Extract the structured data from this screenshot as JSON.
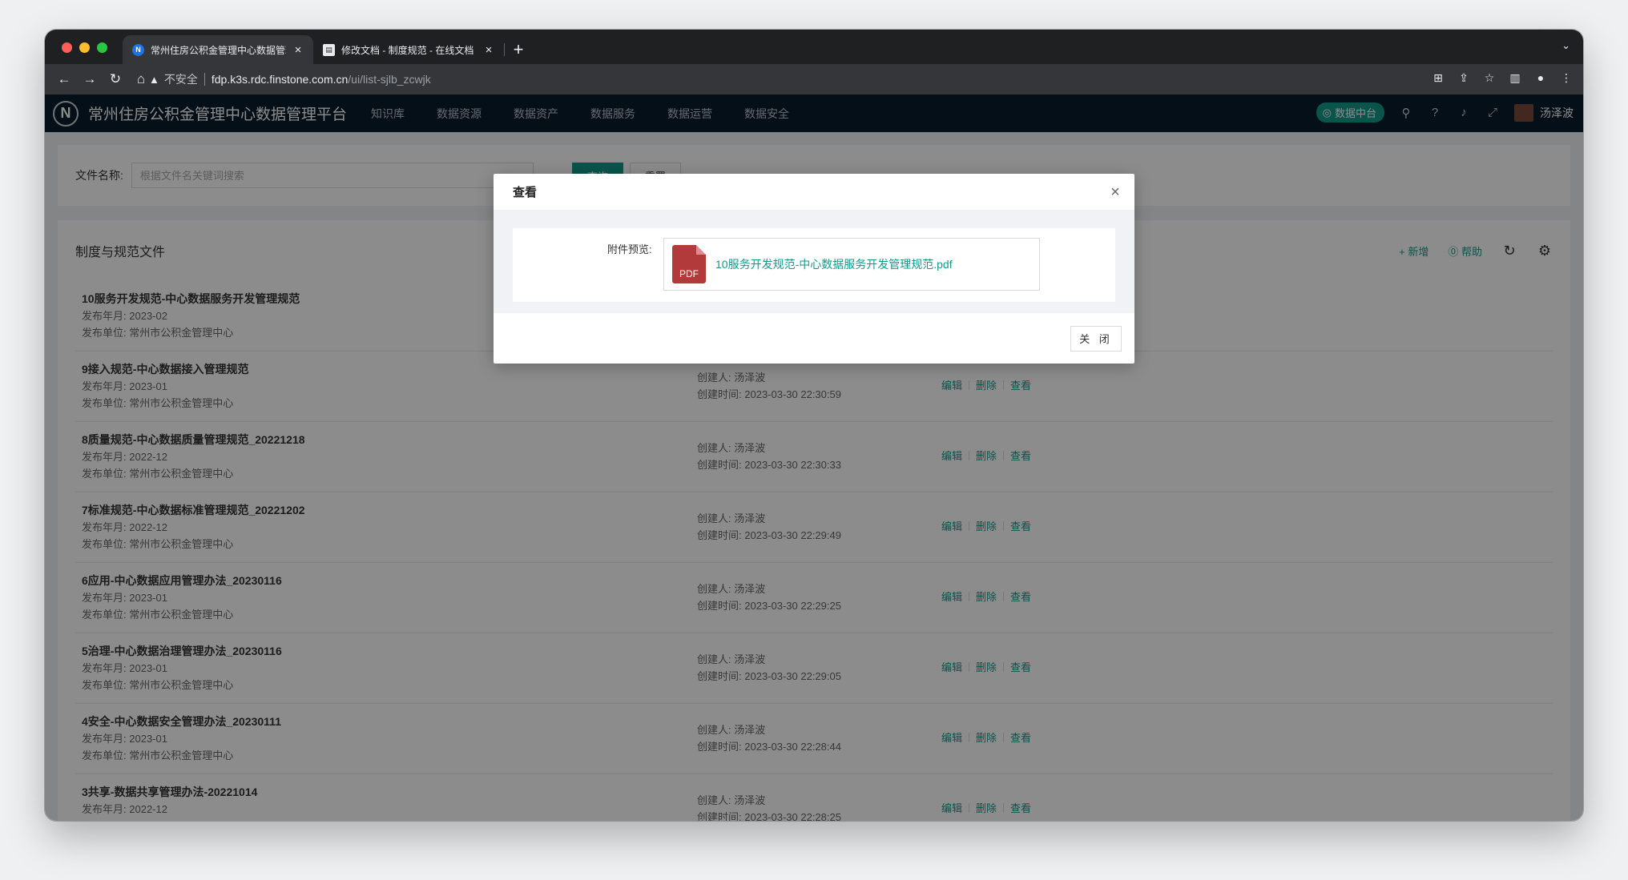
{
  "browser": {
    "tabs": [
      {
        "title": "常州住房公积金管理中心数据管理平台",
        "favicon": "N",
        "active": true
      },
      {
        "title": "修改文档 - 制度规范 - 在线文档",
        "favicon": "doc",
        "active": false
      }
    ],
    "address": {
      "security": "不安全",
      "host": "fdp.k3s.rdc.finstone.com.cn",
      "path": "/ui/list-sjlb_zcwjk"
    }
  },
  "app": {
    "logo": "N",
    "name": "常州住房公积金管理中心数据管理平台",
    "nav": [
      "知识库",
      "数据资源",
      "数据资产",
      "数据服务",
      "数据运营",
      "数据安全"
    ],
    "badge": "数据中台",
    "user": "汤泽波"
  },
  "search": {
    "label": "文件名称:",
    "placeholder": "根据文件名关键词搜索",
    "query_btn": "查询",
    "reset_btn": "重置"
  },
  "panel": {
    "title": "制度与规范文件",
    "add": "+ 新增",
    "help": "⓪ 帮助"
  },
  "labels": {
    "month": "发布年月:",
    "unit": "发布单位:",
    "creator": "创建人:",
    "created": "创建时间:",
    "edit": "编辑",
    "delete": "删除",
    "view": "查看"
  },
  "rows": [
    {
      "name": "10服务开发规范-中心数据服务开发管理规范",
      "month": "2023-02",
      "unit": "常州市公积金管理中心",
      "creator": "",
      "created": ""
    },
    {
      "name": "9接入规范-中心数据接入管理规范",
      "month": "2023-01",
      "unit": "常州市公积金管理中心",
      "creator": "汤泽波",
      "created": "2023-03-30 22:30:59"
    },
    {
      "name": "8质量规范-中心数据质量管理规范_20221218",
      "month": "2022-12",
      "unit": "常州市公积金管理中心",
      "creator": "汤泽波",
      "created": "2023-03-30 22:30:33"
    },
    {
      "name": "7标准规范-中心数据标准管理规范_20221202",
      "month": "2022-12",
      "unit": "常州市公积金管理中心",
      "creator": "汤泽波",
      "created": "2023-03-30 22:29:49"
    },
    {
      "name": "6应用-中心数据应用管理办法_20230116",
      "month": "2023-01",
      "unit": "常州市公积金管理中心",
      "creator": "汤泽波",
      "created": "2023-03-30 22:29:25"
    },
    {
      "name": "5治理-中心数据治理管理办法_20230116",
      "month": "2023-01",
      "unit": "常州市公积金管理中心",
      "creator": "汤泽波",
      "created": "2023-03-30 22:29:05"
    },
    {
      "name": "4安全-中心数据安全管理办法_20230111",
      "month": "2023-01",
      "unit": "常州市公积金管理中心",
      "creator": "汤泽波",
      "created": "2023-03-30 22:28:44"
    },
    {
      "name": "3共享-数据共享管理办法-20221014",
      "month": "2022-12",
      "unit": "",
      "creator": "汤泽波",
      "created": "2023-03-30 22:28:25"
    }
  ],
  "modal": {
    "title": "查看",
    "preview_label": "附件预览:",
    "file_icon": "PDF",
    "file_name": "10服务开发规范-中心数据服务开发管理规范.pdf",
    "close_btn": "关 闭"
  },
  "colors": {
    "accent": "#139a8b",
    "header_bg": "#0a1d2a",
    "pdf": "#b33a3a"
  }
}
